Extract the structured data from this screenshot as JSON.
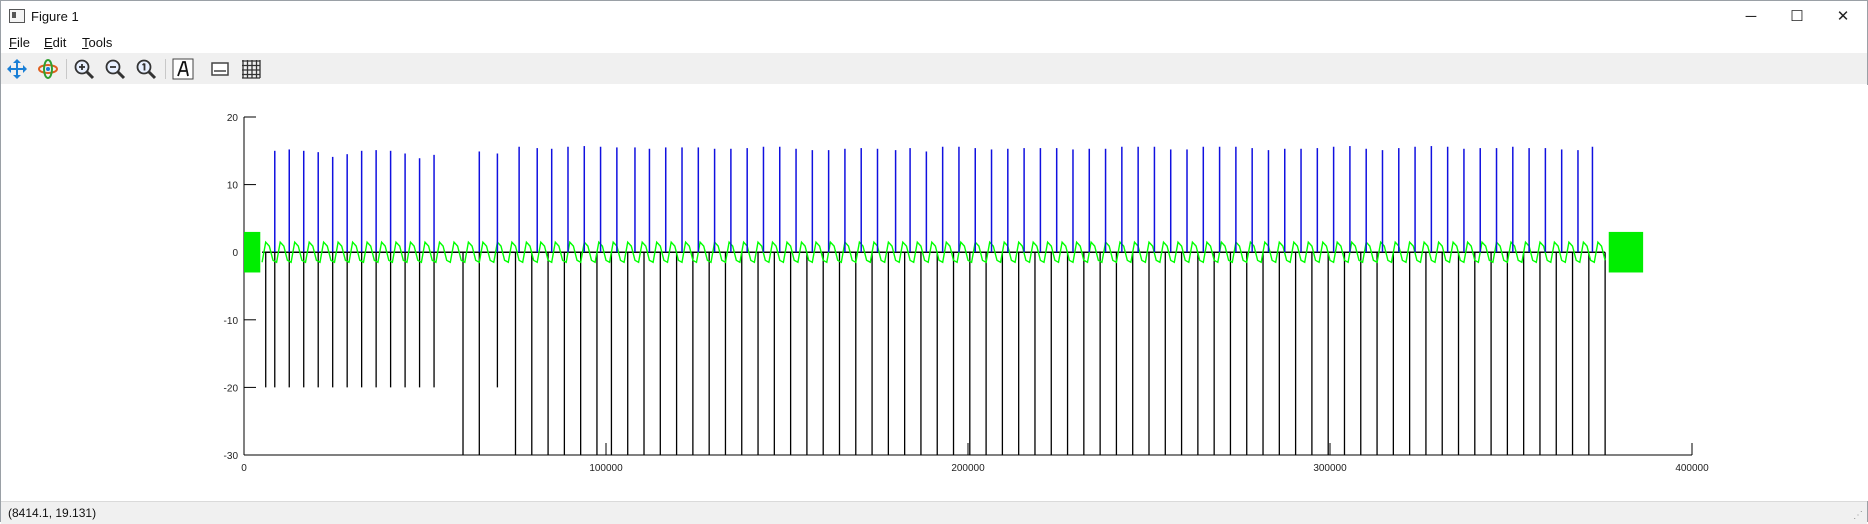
{
  "window": {
    "title": "Figure 1",
    "controls": {
      "minimize": "─",
      "maximize": "☐",
      "close": "✕"
    }
  },
  "menubar": {
    "items": [
      {
        "underline": "F",
        "rest": "ile"
      },
      {
        "underline": "E",
        "rest": "dit"
      },
      {
        "underline": "T",
        "rest": "ools"
      }
    ]
  },
  "toolbar": {
    "tools": [
      "pan-icon",
      "rotate-icon",
      "zoom-in-icon",
      "zoom-out-icon",
      "zoom-reset-icon",
      "text-icon",
      "legend-icon",
      "grid-icon"
    ]
  },
  "status": {
    "coords": "(8414.1, 19.131)"
  },
  "chart_data": {
    "type": "line",
    "xlim": [
      0,
      400000
    ],
    "ylim": [
      -30,
      20
    ],
    "x_ticks": [
      0,
      100000,
      200000,
      300000,
      400000
    ],
    "x_tick_labels": [
      "0",
      "100000",
      "200000",
      "300000",
      "400000"
    ],
    "y_ticks": [
      20,
      10,
      0,
      -10,
      -20,
      -30
    ],
    "y_tick_labels": [
      "20",
      "10",
      "0",
      "-10",
      "-20",
      "-30"
    ],
    "colors": {
      "spikes": "#1010e0",
      "negatives": "#000000",
      "wave": "#00ff00",
      "markers": "#00ee00"
    },
    "series": [
      {
        "style": "blue-positive-spikes",
        "x": [
          8500,
          12500,
          16500,
          20500,
          24500,
          28500,
          32500,
          36500,
          40500,
          44500,
          48500,
          52500,
          65000,
          70000,
          76000,
          81000,
          85000,
          89500,
          94000,
          98500,
          103000,
          108000,
          112000,
          116500,
          121000,
          125500,
          130000,
          134500,
          139000,
          143500,
          148000,
          152500,
          157000,
          161500,
          166000,
          170500,
          175000,
          180000,
          184000,
          188500,
          193000,
          197500,
          202000,
          206500,
          211000,
          215500,
          220000,
          224500,
          229000,
          233500,
          238000,
          242500,
          247000,
          251500,
          256000,
          260500,
          265000,
          269500,
          274000,
          278500,
          283000,
          287500,
          292000,
          296500,
          301000,
          305500,
          310000,
          314500,
          319000,
          323500,
          328000,
          332500,
          337000,
          341500,
          346000,
          350500,
          355000,
          359500,
          364000,
          368500,
          372500
        ],
        "y": [
          15,
          15.2,
          15,
          14.8,
          14.1,
          14.5,
          15,
          15.1,
          15,
          14.6,
          13.9,
          14.4,
          14.9,
          14.6,
          15.6,
          15.4,
          15.3,
          15.6,
          15.7,
          15.6,
          15.5,
          15.5,
          15.3,
          15.5,
          15.5,
          15.5,
          15.3,
          15.3,
          15.4,
          15.6,
          15.6,
          15.3,
          15.1,
          15.1,
          15.3,
          15.4,
          15.3,
          15.1,
          15.4,
          14.9,
          15.6,
          15.6,
          15.4,
          15.2,
          15.3,
          15.4,
          15.4,
          15.4,
          15.2,
          15.3,
          15.3,
          15.6,
          15.6,
          15.6,
          15.2,
          15.2,
          15.6,
          15.6,
          15.6,
          15.4,
          15.1,
          15.3,
          15.3,
          15.4,
          15.6,
          15.7,
          15.3,
          15.1,
          15.4,
          15.6,
          15.7,
          15.6,
          15.3,
          15.4,
          15.4,
          15.6,
          15.4,
          15.4,
          15.2,
          15.1,
          15.6
        ]
      },
      {
        "style": "black-negative-spikes",
        "x": [
          6000,
          8500,
          12500,
          16500,
          20500,
          24500,
          28500,
          32500,
          36500,
          40500,
          44500,
          48500,
          52500,
          60500,
          65000,
          70000,
          75000,
          79500,
          84000,
          88500,
          93000,
          97500,
          101500,
          106000,
          110500,
          115000,
          119500,
          124000,
          128500,
          133000,
          137500,
          142000,
          146500,
          151000,
          155500,
          160000,
          164500,
          169000,
          173500,
          178000,
          182500,
          187000,
          191500,
          196000,
          200500,
          205000,
          209500,
          214000,
          218500,
          223000,
          227500,
          232000,
          236500,
          241000,
          245500,
          250000,
          254500,
          259000,
          263500,
          268000,
          272500,
          277000,
          281500,
          286000,
          290500,
          295000,
          299500,
          304000,
          308500,
          313000,
          317500,
          322000,
          326500,
          331000,
          335500,
          340000,
          344500,
          349000,
          353500,
          358000,
          362500,
          367000,
          371500,
          376000
        ],
        "y": [
          -20,
          -20,
          -20,
          -20,
          -20,
          -20,
          -20,
          -20,
          -20,
          -20,
          -20,
          -20,
          -20,
          -30,
          -30,
          -20,
          -30,
          -30,
          -30,
          -30,
          -30,
          -30,
          -30,
          -30,
          -30,
          -30,
          -30,
          -30,
          -30,
          -30,
          -30,
          -30,
          -30,
          -30,
          -30,
          -30,
          -30,
          -30,
          -30,
          -30,
          -30,
          -30,
          -30,
          -30,
          -30,
          -30,
          -30,
          -30,
          -30,
          -30,
          -30,
          -30,
          -30,
          -30,
          -30,
          -30,
          -30,
          -30,
          -30,
          -30,
          -30,
          -30,
          -30,
          -30,
          -30,
          -30,
          -30,
          -30,
          -30,
          -30,
          -30,
          -30,
          -30,
          -30,
          -30,
          -30,
          -30,
          -30,
          -30,
          -30,
          -30,
          -30,
          -30,
          -30
        ]
      },
      {
        "style": "green-oscillation",
        "x_start": 5000,
        "x_end": 376000,
        "amplitude": 1.5
      }
    ],
    "markers": [
      {
        "x_start": 0,
        "x_end": 4500,
        "y_low": -3,
        "y_high": 3
      },
      {
        "x_start": 377000,
        "x_end": 386500,
        "y_low": -3,
        "y_high": 3
      }
    ]
  }
}
